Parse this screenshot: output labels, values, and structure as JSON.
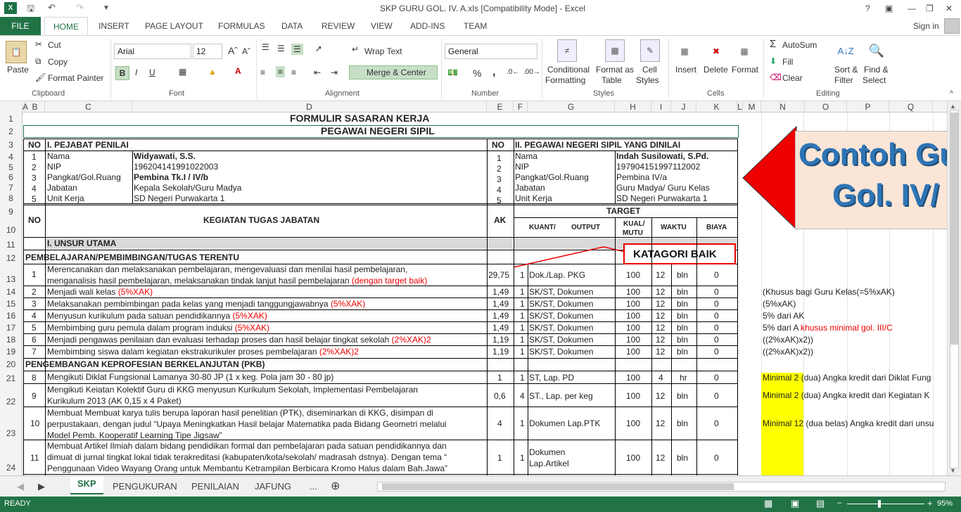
{
  "window": {
    "title": "SKP GURU GOL. IV. A.xls  [Compatibility Mode] - Excel",
    "help": "?",
    "signin": "Sign in"
  },
  "ribbon_tabs": [
    "FILE",
    "HOME",
    "INSERT",
    "PAGE LAYOUT",
    "FORMULAS",
    "DATA",
    "REVIEW",
    "VIEW",
    "ADD-INS",
    "TEAM"
  ],
  "ribbon": {
    "clipboard": {
      "paste": "Paste",
      "cut": "Cut",
      "copy": "Copy",
      "format_painter": "Format Painter",
      "label": "Clipboard"
    },
    "font": {
      "name": "Arial",
      "size": "12",
      "label": "Font",
      "bold": "B",
      "italic": "I",
      "underline": "U"
    },
    "alignment": {
      "wrap": "Wrap Text",
      "merge": "Merge & Center",
      "label": "Alignment"
    },
    "number": {
      "format": "General",
      "percent": "%",
      "comma": ",",
      "label": "Number"
    },
    "styles": {
      "conditional": "Conditional",
      "conditional2": "Formatting",
      "format_as": "Format as",
      "format_as2": "Table",
      "cell": "Cell",
      "cell2": "Styles",
      "label": "Styles"
    },
    "cells": {
      "insert": "Insert",
      "delete": "Delete",
      "format": "Format",
      "label": "Cells"
    },
    "editing": {
      "autosum": "AutoSum",
      "fill": "Fill",
      "clear": "Clear",
      "sort": "Sort &",
      "sort2": "Filter",
      "find": "Find &",
      "find2": "Select",
      "label": "Editing"
    }
  },
  "columns": [
    "A",
    "B",
    "C",
    "D",
    "E",
    "F",
    "G",
    "H",
    "I",
    "J",
    "K",
    "L",
    "M",
    "N",
    "O",
    "P",
    "Q"
  ],
  "rows": [
    "1",
    "2",
    "3",
    "4",
    "5",
    "6",
    "7",
    "8",
    "9",
    "10",
    "11",
    "12",
    "13",
    "14",
    "15",
    "16",
    "17",
    "18",
    "19",
    "20",
    "21",
    "22",
    "23",
    "24"
  ],
  "sheet": {
    "title1": "FORMULIR SASARAN KERJA",
    "title2": "PEGAWAI NEGERI SIPIL",
    "no": "NO",
    "pejabat": "I. PEJABAT PENILAI",
    "pegawai": "II. PEGAWAI NEGERI SIPIL YANG DINILAI",
    "labels": [
      "Nama",
      "NIP",
      "Pangkat/Gol.Ruang",
      "Jabatan",
      "Unit Kerja"
    ],
    "pejabat_values": [
      "Widyawati, S.S.",
      "196204141991022003",
      "Pembina Tk.I / IV/b",
      "Kepala Sekolah/Guru Madya",
      "SD Negeri Purwakarta 1"
    ],
    "pegawai_values": [
      "Indah Susilowati, S.Pd.",
      "197904151997112002",
      "Pembina  IV/a",
      "Guru Madya/ Guru Kelas",
      "SD Negeri Purwakarta 1"
    ],
    "nums": [
      "1",
      "2",
      "3",
      "4",
      "5"
    ],
    "kegiatan": "KEGIATAN TUGAS JABATAN",
    "ak": "AK",
    "target": "TARGET",
    "kuant": "KUANT/",
    "output": "OUTPUT",
    "kual1": "KUAL/",
    "kual2": "MUTU",
    "waktu": "WAKTU",
    "biaya": "BIAYA",
    "unsur": "I. UNSUR UTAMA",
    "section1": "PEMBELAJARAN/PEMBIMBINGAN/TUGAS TERENTU",
    "section2": "PENGEMBANGAN KEPROFESIAN BERKELANJUTAN (PKB)",
    "katagori": "KATAGORI BAIK",
    "banner1": "Contoh Gu",
    "banner2": "Gol. IV/",
    "tasks": [
      {
        "no": "1",
        "line1": "Merencanakan dan melaksanakan pembelajaran, mengevaluasi dan menilai hasil pembelajaran,",
        "line2": "menganalisis hasil pembelajaran, melaksanakan tindak lanjut hasil pembelajaran ",
        "red": "(dengan target baik)",
        "ak": "29,75",
        "kuant": "1",
        "output": "Dok./Lap. PKG",
        "mutu": "100",
        "waktu": "12",
        "satuan": "bln",
        "biaya": "0"
      },
      {
        "no": "2",
        "line1": "Menjadi wali kelas ",
        "red": "(5%XAK)",
        "ak": "1,49",
        "kuant": "1",
        "output": "SK/ST, Dokumen",
        "mutu": "100",
        "waktu": "12",
        "satuan": "bln",
        "biaya": "0",
        "note": "(Khusus bagi Guru Kelas(=5%xAK)"
      },
      {
        "no": "3",
        "line1": "Melaksanakan pembimbingan pada kelas yang menjadi tanggungjawabnya ",
        "red": "(5%XAK)",
        "ak": "1,49",
        "kuant": "1",
        "output": "SK/ST, Dokumen",
        "mutu": "100",
        "waktu": "12",
        "satuan": "bln",
        "biaya": "0",
        "note": "(5%xAK)"
      },
      {
        "no": "4",
        "line1": "Menyusun kurikulum pada satuan pendidikannya ",
        "red": "(5%XAK)",
        "ak": "1,49",
        "kuant": "1",
        "output": "SK/ST, Dokumen",
        "mutu": "100",
        "waktu": "12",
        "satuan": "bln",
        "biaya": "0",
        "note": "5% dari AK"
      },
      {
        "no": "5",
        "line1": "Membimbing guru pemula dalam program induksi ",
        "red": "(5%XAK)",
        "ak": "1,49",
        "kuant": "1",
        "output": "SK/ST, Dokumen",
        "mutu": "100",
        "waktu": "12",
        "satuan": "bln",
        "biaya": "0",
        "note": "5% dari A",
        "note_red": "khusus minimal gol. III/C"
      },
      {
        "no": "6",
        "line1": "Menjadi pengawas penilaian dan evaluasi terhadap proses dan hasil belajar tingkat sekolah ",
        "red": "(2%XAK)2",
        "ak": "1,19",
        "kuant": "1",
        "output": "SK/ST, Dokumen",
        "mutu": "100",
        "waktu": "12",
        "satuan": "bln",
        "biaya": "0",
        "note": "((2%xAK)x2))"
      },
      {
        "no": "7",
        "line1": "Membimbing siswa dalam kegiatan ekstrakurikuler proses pembelajaran  ",
        "red": "(2%XAK)2",
        "ak": "1,19",
        "kuant": "1",
        "output": "SK/ST, Dokumen",
        "mutu": "100",
        "waktu": "12",
        "satuan": "bln",
        "biaya": "0",
        "note": "((2%xAK)x2))"
      }
    ],
    "pkb": [
      {
        "no": "8",
        "line1": "Mengikuti  Diklat Fungsional Lamanya 30-80 JP (1 x  keg. Pola jam 30 - 80 jp)",
        "ak": "1",
        "kuant": "1",
        "output": "ST, Lap. PD",
        "mutu": "100",
        "waktu": "4",
        "satuan": "hr",
        "biaya": "0",
        "note_y": "Minimal 2",
        "note": " (dua) Angka kredit  dari Diklat Fung"
      },
      {
        "no": "9",
        "line1": "Mengikuti Keiatan Kolektif Guru di KKG menyusun Kurikulum Sekolah, Implementasi Pembelajaran",
        "line2": "Kurikulum 2013 (AK 0,15 x 4 Paket)",
        "ak": "0,6",
        "kuant": "4",
        "output": "ST., Lap. per keg",
        "mutu": "100",
        "waktu": "12",
        "satuan": "bln",
        "biaya": "0",
        "note_y": "Minimal 2",
        "note": " (dua) Angka kredit  dari Kegiatan K"
      },
      {
        "no": "10",
        "line1": "Membuat Membuat karya tulis berupa laporan hasil penelitian (PTK), diseminarkan di KKG, disimpan di",
        "line2": "perpustakaan, dengan judul “Upaya Meningkatkan Hasil belajar Matematika pada Bidang Geometri melalui",
        "line3": "Model Pemb. Kooperatif Learning Tipe Jigsaw”",
        "ak": "4",
        "kuant": "1",
        "output": "Dokumen Lap.PTK",
        "mutu": "100",
        "waktu": "12",
        "satuan": "bln",
        "biaya": "0",
        "note_y": "Minimal 12",
        "note": " (dua belas) Angka kredit dari unsu"
      },
      {
        "no": "11",
        "line1": "Membuat Artikel Ilmiah dalam bidang pendidikan formal dan pembelajaran pada satuan pendidikannya dan",
        "line2": "dimuat di jurnal tingkat lokal tidak terakreditasi (kabupaten/kota/sekolah/ madrasah dstnya). Dengan tema “",
        "line3": "Penggunaan Video Wayang Orang untuk Membantu Ketrampilan Berbicara Kromo Halus dalam Bah.Jawa”",
        "ak": "1",
        "kuant": "1",
        "output": "Dokumen",
        "output2": "Lap.Artikel",
        "mutu": "100",
        "waktu": "12",
        "satuan": "bln",
        "biaya": "0"
      }
    ]
  },
  "sheet_tabs": [
    "SKP",
    "PENGUKURAN",
    "PENILAIAN",
    "JAFUNG",
    "..."
  ],
  "status": {
    "ready": "READY",
    "zoom": "95%"
  },
  "colors": {
    "excel_green": "#217346",
    "accent_red": "#e00000",
    "banner_blue": "#2e75b6",
    "highlight": "#ffff00"
  }
}
